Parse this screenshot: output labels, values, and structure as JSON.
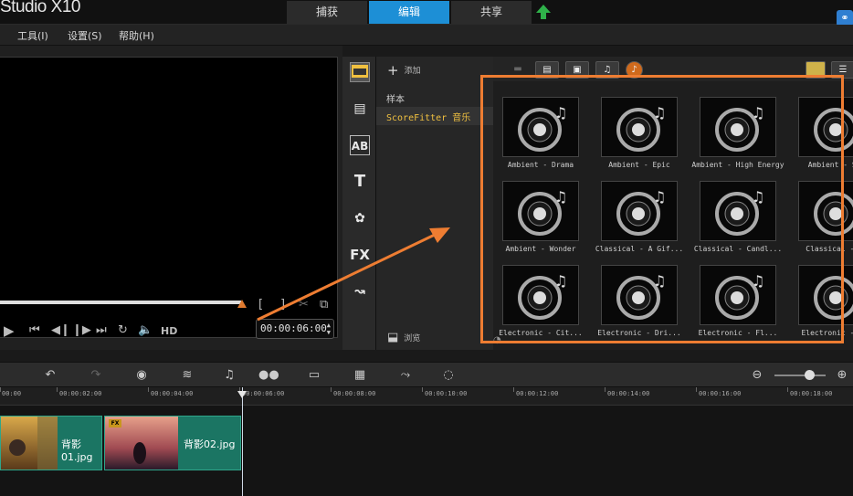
{
  "app": {
    "title": "Studio X10"
  },
  "top_tabs": [
    {
      "label": "捕获",
      "active": false
    },
    {
      "label": "编辑",
      "active": true
    },
    {
      "label": "共享",
      "active": false
    }
  ],
  "menu": [
    "工具(I)",
    "设置(S)",
    "帮助(H)"
  ],
  "player": {
    "timecode": "00:00:06:00",
    "hd_label": "HD",
    "bracket_in": "[",
    "bracket_out": "]"
  },
  "library": {
    "add_label": "添加",
    "browse_label": "浏览",
    "folders": [
      {
        "label": "样本",
        "selected": false
      },
      {
        "label": "ScoreFitter 音乐",
        "selected": true
      }
    ],
    "toolbar_icons": [
      "media-icon",
      "instant-project-icon",
      "transition-icon",
      "title-icon",
      "graphic-icon",
      "filter-icon",
      "path-icon"
    ],
    "toolbar_glyphs": [
      "",
      "",
      "AB",
      "T",
      "",
      "FX",
      ""
    ],
    "items": [
      "Ambient - Drama",
      "Ambient - Epic",
      "Ambient - High Energy",
      "Ambient - Sus",
      "Ambient - Wonder",
      "Classical - A Gif...",
      "Classical - Candl...",
      "Classical - Co",
      "Electronic - Cit...",
      "Electronic - Dri...",
      "Electronic - Fl...",
      "Electronic - ..."
    ]
  },
  "timeline": {
    "ruler": [
      "00:00",
      "00:00:02:00",
      "00:00:04:00",
      "00:00:06:00",
      "00:00:08:00",
      "00:00:10:00",
      "00:00:12:00",
      "00:00:14:00",
      "00:00:16:00",
      "00:00:18:00"
    ],
    "clips": [
      {
        "label": "背影01.jpg",
        "fx": ""
      },
      {
        "label": "背影02.jpg",
        "fx": "FX"
      }
    ]
  },
  "colors": {
    "accent": "#1d8fd6",
    "highlight": "#ee7d32",
    "clip": "#1b7563"
  }
}
